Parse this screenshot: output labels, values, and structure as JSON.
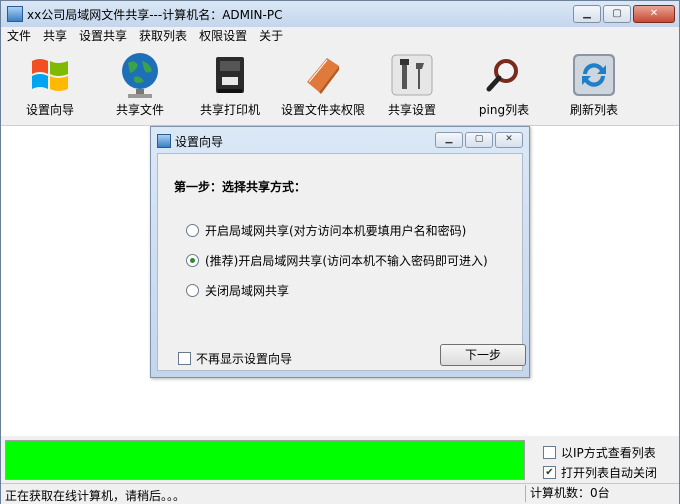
{
  "window": {
    "title": "xx公司局域网文件共享---计算机名：ADMIN-PC"
  },
  "menu": [
    "文件",
    "共享",
    "设置共享",
    "获取列表",
    "权限设置",
    "关于"
  ],
  "toolbar": [
    {
      "label": "设置向导",
      "icon": "windows-logo-icon"
    },
    {
      "label": "共享文件",
      "icon": "globe-icon"
    },
    {
      "label": "共享打印机",
      "icon": "printer-icon"
    },
    {
      "label": "设置文件夹权限",
      "icon": "notebook-icon"
    },
    {
      "label": "共享设置",
      "icon": "tools-icon"
    },
    {
      "label": "ping列表",
      "icon": "magnifier-icon"
    },
    {
      "label": "刷新列表",
      "icon": "refresh-icon"
    }
  ],
  "dialog": {
    "title": "设置向导",
    "step_title": "第一步：选择共享方式：",
    "options": [
      "开启局域网共享(对方访问本机要填用户名和密码)",
      "(推荐)开启局域网共享(访问本机不输入密码即可进入)",
      "关闭局域网共享"
    ],
    "selected_option": 1,
    "dont_show_label": "不再显示设置向导",
    "dont_show_checked": false,
    "next_label": "下一步"
  },
  "progress": {
    "value": 1.0,
    "color": "#00ff00"
  },
  "options": {
    "ip_view_label": "以IP方式查看列表",
    "ip_view_checked": false,
    "auto_close_label": "打开列表自动关闭",
    "auto_close_checked": true
  },
  "status": {
    "message": "正在获取在线计算机，请稍后。。。",
    "count": "计算机数：0台"
  }
}
